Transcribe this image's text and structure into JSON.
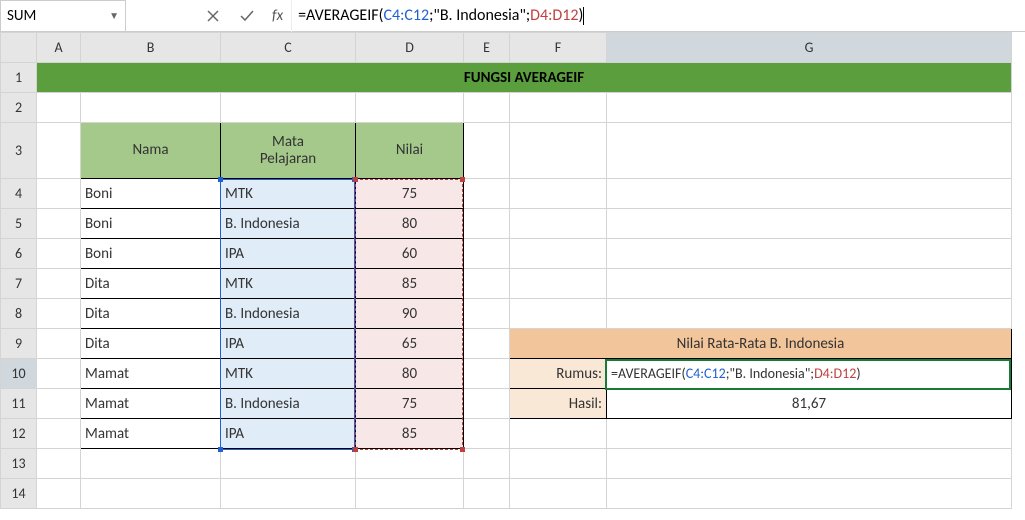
{
  "nameBox": "SUM",
  "formula": {
    "prefix": "=AVERAGEIF(",
    "ref1": "C4:C12",
    "mid1": ";\"B. Indonesia\";",
    "ref2": "D4:D12",
    "suffix": ")"
  },
  "fxLabel": "fx",
  "columns": [
    "A",
    "B",
    "C",
    "D",
    "E",
    "F",
    "G"
  ],
  "rows": [
    "1",
    "2",
    "3",
    "4",
    "5",
    "6",
    "7",
    "8",
    "9",
    "10",
    "11",
    "12",
    "13",
    "14"
  ],
  "title": "FUNGSI AVERAGEIF",
  "headers": {
    "nama": "Nama",
    "mapel": "Mata Pelajaran",
    "nilai": "Nilai"
  },
  "data": [
    {
      "nama": "Boni",
      "mapel": "MTK",
      "nilai": "75"
    },
    {
      "nama": "Boni",
      "mapel": "B. Indonesia",
      "nilai": "80"
    },
    {
      "nama": "Boni",
      "mapel": "IPA",
      "nilai": "60"
    },
    {
      "nama": "Dita",
      "mapel": "MTK",
      "nilai": "85"
    },
    {
      "nama": "Dita",
      "mapel": "B. Indonesia",
      "nilai": "90"
    },
    {
      "nama": "Dita",
      "mapel": "IPA",
      "nilai": "65"
    },
    {
      "nama": "Mamat",
      "mapel": "MTK",
      "nilai": "80"
    },
    {
      "nama": "Mamat",
      "mapel": "B. Indonesia",
      "nilai": "75"
    },
    {
      "nama": "Mamat",
      "mapel": "IPA",
      "nilai": "85"
    }
  ],
  "summary": {
    "title": "Nilai Rata-Rata B. Indonesia",
    "rumusLabel": "Rumus:",
    "hasilLabel": "Hasil:",
    "hasil": "81,67"
  }
}
